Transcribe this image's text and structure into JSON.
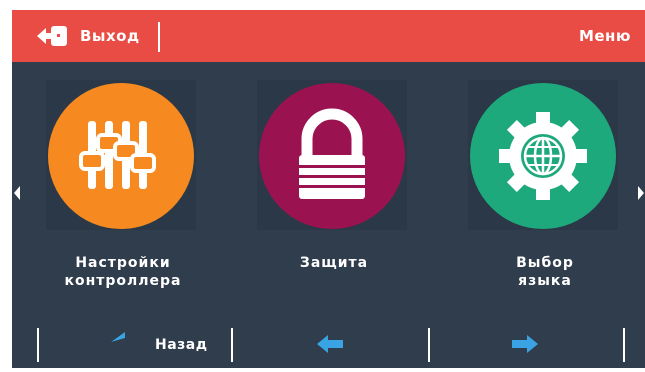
{
  "header": {
    "exit_label": "Выход",
    "menu_title": "Меню"
  },
  "tiles": [
    {
      "label": "Настройки\nконтроллера",
      "icon": "sliders-icon",
      "color": "#f6891f"
    },
    {
      "label": "Защита",
      "icon": "lock-icon",
      "color": "#9b1250"
    },
    {
      "label": "Выбор\nязыка",
      "icon": "gear-globe-icon",
      "color": "#1ea97c"
    }
  ],
  "footer": {
    "back_label": "Назад",
    "prev_icon": "arrow-left-icon",
    "next_icon": "arrow-right-icon"
  },
  "colors": {
    "header_bg": "#e84c44",
    "screen_bg": "#2f3d4d",
    "arrow_blue": "#3aa3e3"
  }
}
